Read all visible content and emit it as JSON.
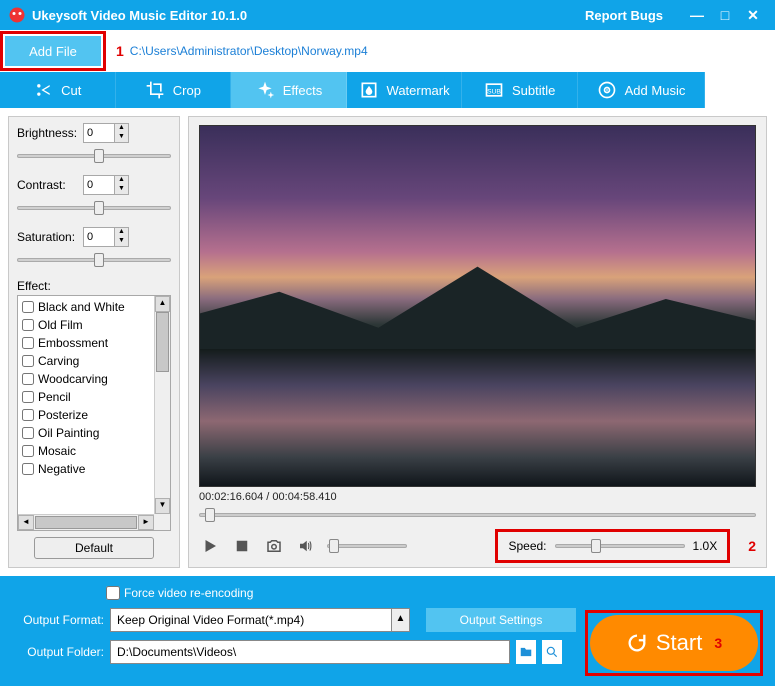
{
  "window": {
    "title": "Ukeysoft Video Music Editor 10.1.0",
    "report": "Report Bugs"
  },
  "addbar": {
    "add_file": "Add File",
    "annotation1": "1",
    "path": "C:\\Users\\Administrator\\Desktop\\Norway.mp4"
  },
  "tabs": {
    "cut": "Cut",
    "crop": "Crop",
    "effects": "Effects",
    "watermark": "Watermark",
    "subtitle": "Subtitle",
    "addmusic": "Add Music"
  },
  "adjust": {
    "brightness_label": "Brightness:",
    "brightness_value": "0",
    "contrast_label": "Contrast:",
    "contrast_value": "0",
    "saturation_label": "Saturation:",
    "saturation_value": "0"
  },
  "effect": {
    "label": "Effect:",
    "items": [
      "Black and White",
      "Old Film",
      "Embossment",
      "Carving",
      "Woodcarving",
      "Pencil",
      "Posterize",
      "Oil Painting",
      "Mosaic",
      "Negative"
    ],
    "default_btn": "Default"
  },
  "preview": {
    "timecode": "00:02:16.604 / 00:04:58.410",
    "speed_label": "Speed:",
    "speed_value": "1.0X",
    "annotation2": "2"
  },
  "bottom": {
    "force_label": "Force video re-encoding",
    "output_format_label": "Output Format:",
    "output_format_value": "Keep Original Video Format(*.mp4)",
    "output_settings": "Output Settings",
    "output_folder_label": "Output Folder:",
    "output_folder_value": "D:\\Documents\\Videos\\",
    "start": "Start",
    "annotation3": "3"
  }
}
